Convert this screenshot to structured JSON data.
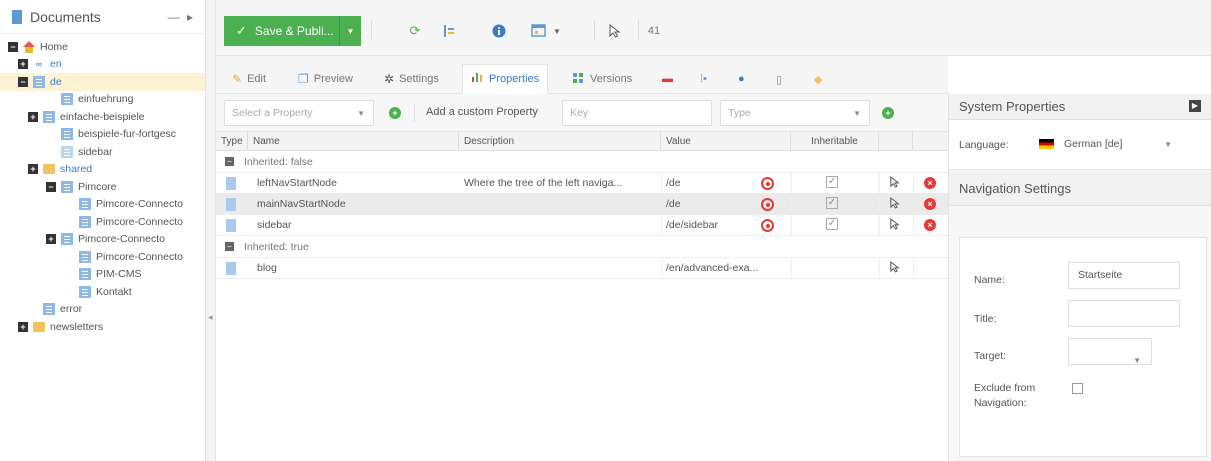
{
  "tree": {
    "title": "Documents",
    "controls": "— ▸",
    "nodes": [
      {
        "label": "Home",
        "icon": "home-icon",
        "toggle": "−"
      },
      {
        "label": "en",
        "icon": "link-icon",
        "toggle": "+"
      },
      {
        "label": "de",
        "icon": "page-icon",
        "toggle": "−"
      },
      {
        "label": "einfuehrung",
        "icon": "page-icon",
        "toggle": ""
      },
      {
        "label": "einfache-beispiele",
        "icon": "page-icon",
        "toggle": "+"
      },
      {
        "label": "beispiele-fur-fortgesc",
        "icon": "page-icon",
        "toggle": ""
      },
      {
        "label": "sidebar",
        "icon": "snippet-icon",
        "toggle": ""
      },
      {
        "label": "shared",
        "icon": "folder-icon",
        "toggle": "+"
      },
      {
        "label": "Pimcore",
        "icon": "page-icon",
        "toggle": "−"
      },
      {
        "label": "Pimcore-Connecto",
        "icon": "page-icon",
        "toggle": ""
      },
      {
        "label": "Pimcore-Connecto",
        "icon": "page-icon",
        "toggle": ""
      },
      {
        "label": "Pimcore-Connecto",
        "icon": "page-icon",
        "toggle": "+"
      },
      {
        "label": "Pimcore-Connecto",
        "icon": "page-icon",
        "toggle": ""
      },
      {
        "label": "PIM-CMS",
        "icon": "page-icon",
        "toggle": ""
      },
      {
        "label": "Kontakt",
        "icon": "page-icon",
        "toggle": ""
      },
      {
        "label": "error",
        "icon": "page-icon",
        "toggle": ""
      },
      {
        "label": "newsletters",
        "icon": "folder-icon",
        "toggle": "+"
      }
    ]
  },
  "toolbar": {
    "save_label": "Save & Publi...",
    "count": "41"
  },
  "tabs": [
    {
      "label": "Edit"
    },
    {
      "label": "Preview"
    },
    {
      "label": "Settings"
    },
    {
      "label": "Properties"
    },
    {
      "label": "Versions"
    }
  ],
  "prop_bar": {
    "select_placeholder": "Select a Property",
    "add_custom": "Add a custom Property",
    "key_placeholder": "Key",
    "type_placeholder": "Type"
  },
  "grid": {
    "columns": [
      "Type",
      "Name",
      "Description",
      "Value",
      "Inheritable"
    ],
    "groups": [
      {
        "label": "Inherited: false",
        "rows": [
          {
            "name": "leftNavStartNode",
            "description": "Where the tree of the left naviga...",
            "value": "/de"
          },
          {
            "name": "mainNavStartNode",
            "description": "",
            "value": "/de"
          },
          {
            "name": "sidebar",
            "description": "",
            "value": "/de/sidebar"
          }
        ]
      },
      {
        "label": "Inherited: true",
        "rows": [
          {
            "name": "blog",
            "description": "",
            "value": "/en/advanced-exa..."
          }
        ]
      }
    ]
  },
  "system": {
    "title": "System Properties",
    "language_label": "Language:",
    "language_value": "German [de]"
  },
  "nav": {
    "title": "Navigation Settings",
    "name_label": "Name:",
    "name_value": "Startseite",
    "title_label": "Title:",
    "target_label": "Target:",
    "exclude_label": "Exclude from Navigation:"
  }
}
